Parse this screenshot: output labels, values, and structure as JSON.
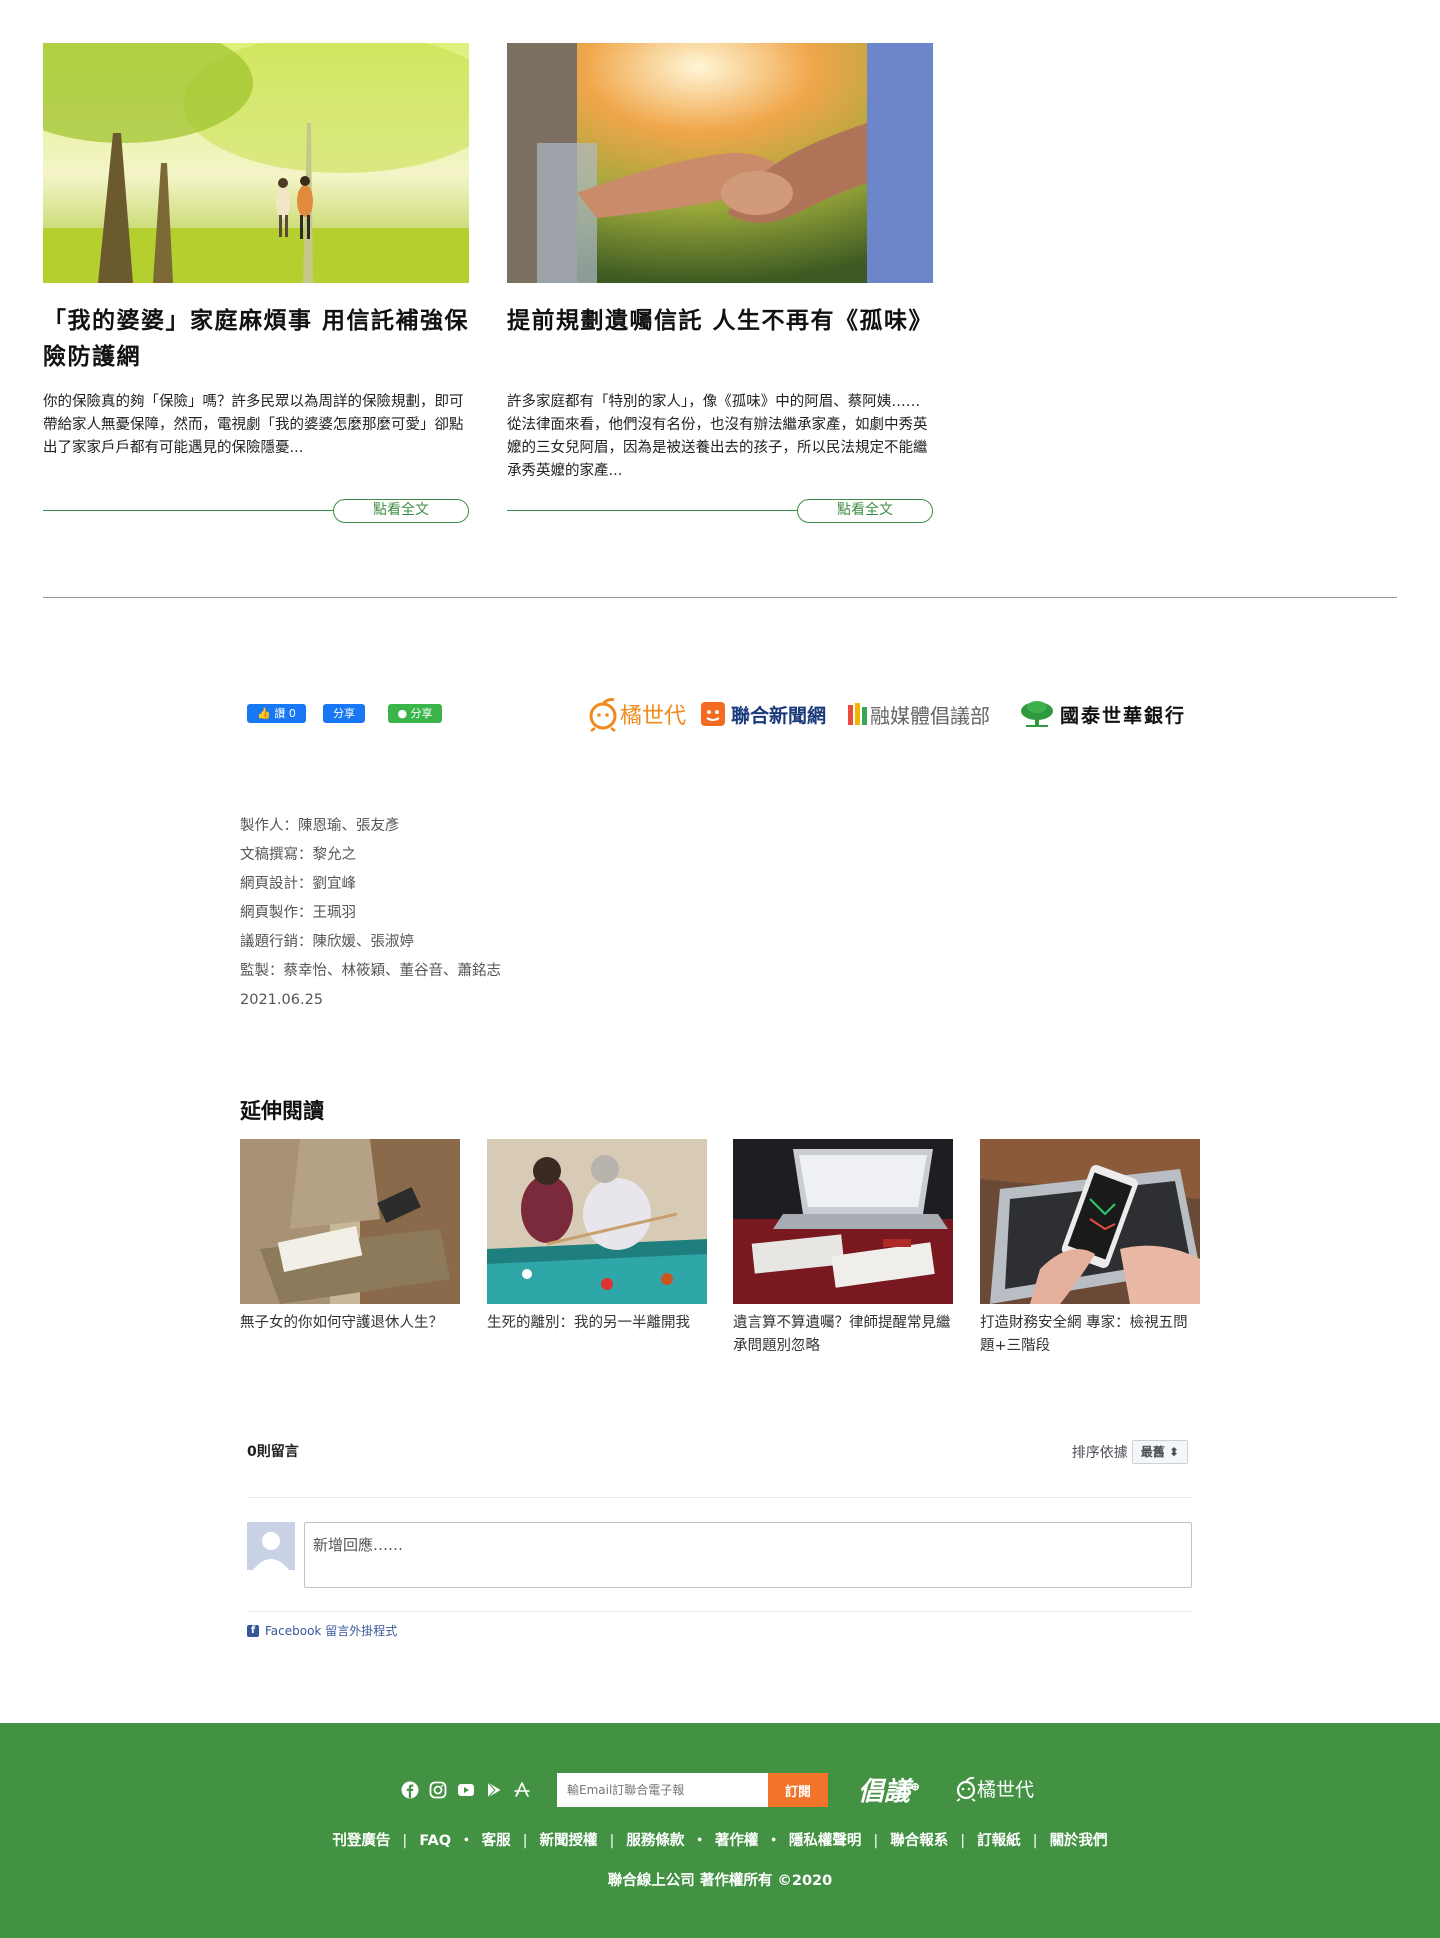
{
  "articles": [
    {
      "title": "「我的婆婆」家庭麻煩事 用信託補強保險防護網",
      "excerpt": "你的保險真的夠「保險」嗎？許多民眾以為周詳的保險規劃，即可帶給家人無憂保障，然而，電視劇「我的婆婆怎麼那麼可愛」卻點出了家家戶戶都有可能遇見的保險隱憂...",
      "readmore": "點看全文"
    },
    {
      "title": "提前規劃遺囑信託 人生不再有《孤味》",
      "excerpt": "許多家庭都有「特別的家人」，像《孤味》中的阿眉、蔡阿姨……從法律面來看，他們沒有名份，也沒有辦法繼承家產，如劇中秀英嬤的三女兒阿眉，因為是被送養出去的孩子，所以民法規定不能繼承秀英嬤的家產...",
      "readmore": "點看全文"
    }
  ],
  "share": {
    "fb_like": "讚 0",
    "fb_share": "分享",
    "line_share": "分享"
  },
  "partners": [
    "橘世代",
    "聯合新聞網",
    "融媒體倡議部",
    "國泰世華銀行"
  ],
  "credits": [
    "製作人：陳恩瑜、張友彥",
    "文稿撰寫：黎允之",
    "網頁設計：劉宜峰",
    "網頁製作：王珮羽",
    "議題行銷：陳欣媛、張淑婷",
    "監製：蔡幸怡、林筱穎、董谷音、蕭銘志",
    "2021.06.25"
  ],
  "related": {
    "title": "延伸閱讀",
    "items": [
      "無子女的你如何守護退休人生？",
      "生死的離別：我的另一半離開我",
      "遺言算不算遺囑？律師提醒常見繼承問題別忽略",
      "打造財務安全網 專家：檢視五問題+三階段"
    ]
  },
  "comments": {
    "count": "0則留言",
    "sort_label": "排序依據",
    "sort_value": "最舊 ⬍",
    "placeholder": "新增回應……",
    "plugin": "Facebook 留言外掛程式"
  },
  "footer": {
    "subscribe_placeholder": "輸Email訂聯合電子報",
    "subscribe_button": "訂閱",
    "logo_a": "倡議",
    "logo_b": "橘世代",
    "nav": [
      "刊登廣告",
      "FAQ",
      "客服",
      "新聞授權",
      "服務條款",
      "著作權",
      "隱私權聲明",
      "聯合報系",
      "訂報紙",
      "關於我們"
    ],
    "nav_separator": "|",
    "nav_dot": "・",
    "copyright": "聯合線上公司 著作權所有 ©2020"
  },
  "icons": {
    "social": [
      "facebook-icon",
      "instagram-icon",
      "youtube-icon",
      "google-play-icon",
      "app-store-icon"
    ]
  },
  "colors": {
    "accent_green": "#3e8f43",
    "footer_green": "#439244",
    "subscribe_orange": "#f2732a",
    "facebook_blue": "#1877f2",
    "line_green": "#3bb54a"
  }
}
